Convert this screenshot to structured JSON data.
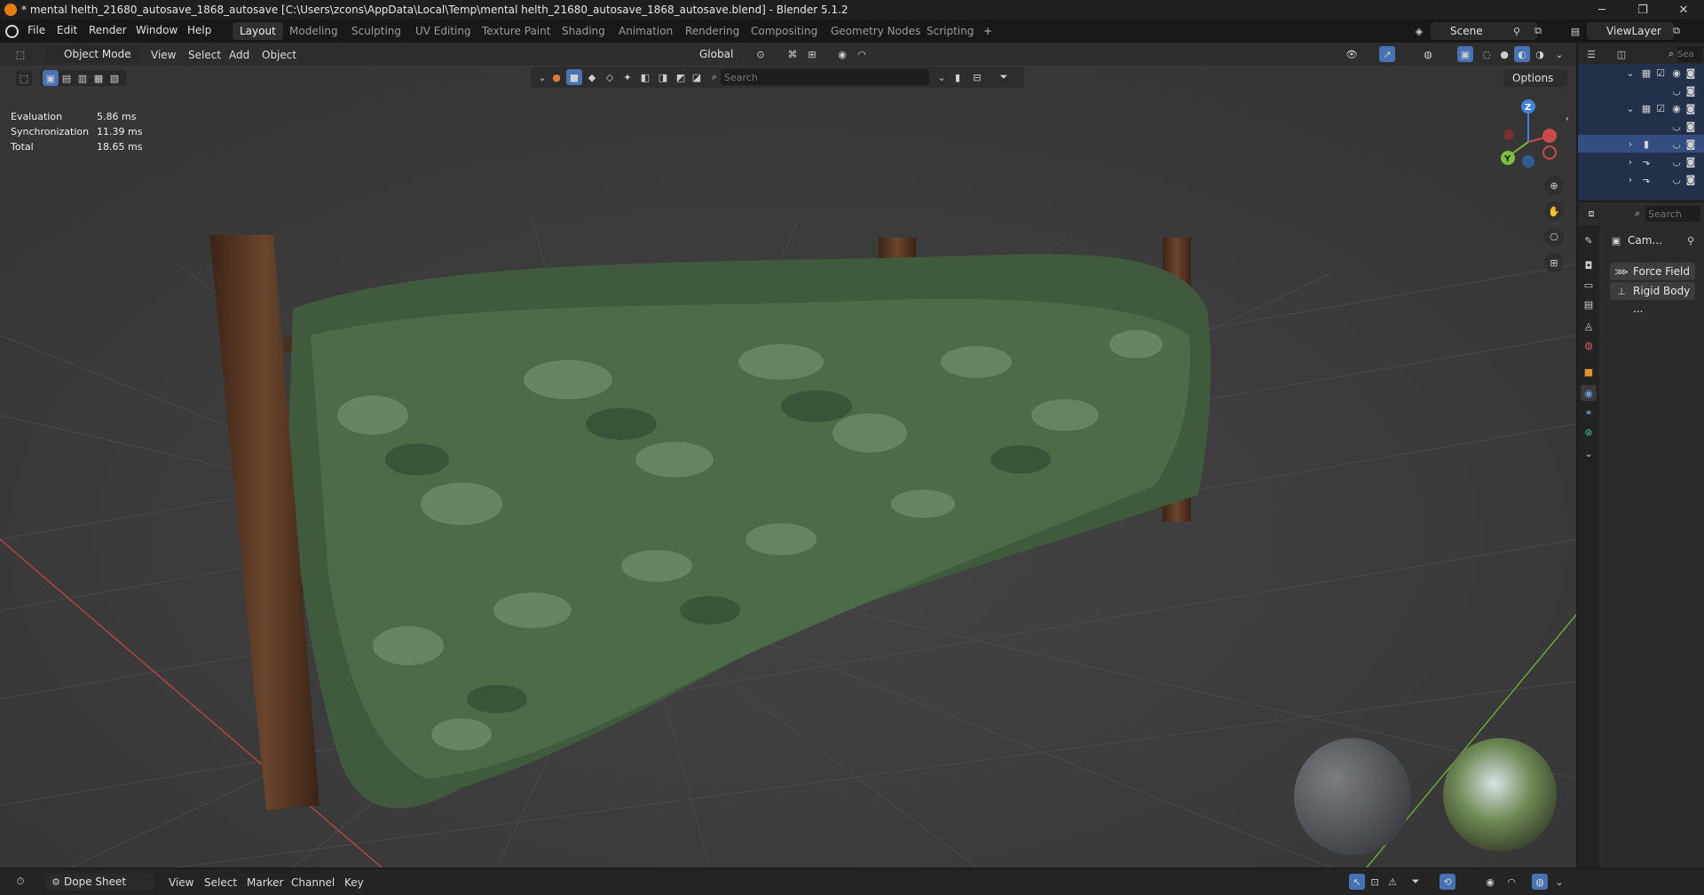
{
  "window": {
    "title": "* mental helth_21680_autosave_1868_autosave [C:\\Users\\zcons\\AppData\\Local\\Temp\\mental helth_21680_autosave_1868_autosave.blend] - Blender 5.1.2",
    "minimize": "─",
    "maximize": "❐",
    "close": "✕"
  },
  "menu": [
    "File",
    "Edit",
    "Render",
    "Window",
    "Help"
  ],
  "workspaces": [
    "Layout",
    "Modeling",
    "Sculpting",
    "UV Editing",
    "Texture Paint",
    "Shading",
    "Animation",
    "Rendering",
    "Compositing",
    "Geometry Nodes",
    "Scripting"
  ],
  "active_workspace": "Layout",
  "add_workspace": "+",
  "scene": {
    "name": "Scene",
    "view_layer": "ViewLayer"
  },
  "viewport_header": {
    "mode": "Object Mode",
    "menus": [
      "View",
      "Select",
      "Add",
      "Object"
    ],
    "orientation": "Global",
    "search_placeholder": "Search",
    "options": "Options"
  },
  "stats": [
    {
      "label": "Evaluation",
      "value": "5.86 ms"
    },
    {
      "label": "Synchronization",
      "value": "11.39 ms"
    },
    {
      "label": "Total",
      "value": "18.65 ms"
    }
  ],
  "gizmo": {
    "z": "Z",
    "y": "Y"
  },
  "outliner": {
    "search_placeholder": "Sea"
  },
  "properties": {
    "search_placeholder": "Search",
    "object_name": "Cam...",
    "buttons": [
      "Force Field",
      "Rigid Body ..."
    ]
  },
  "bottom": {
    "editor": "Dope Sheet",
    "menus": [
      "View",
      "Select",
      "Marker",
      "Channel",
      "Key"
    ]
  },
  "colors": {
    "accent": "#4772b3",
    "viewport_bg": "#3b3b3b",
    "x_axis": "#c84a4a",
    "y_axis": "#7bbf3c",
    "z_axis": "#3f82e0",
    "foliage": "#4c6b48",
    "wood": "#5a3a24"
  }
}
